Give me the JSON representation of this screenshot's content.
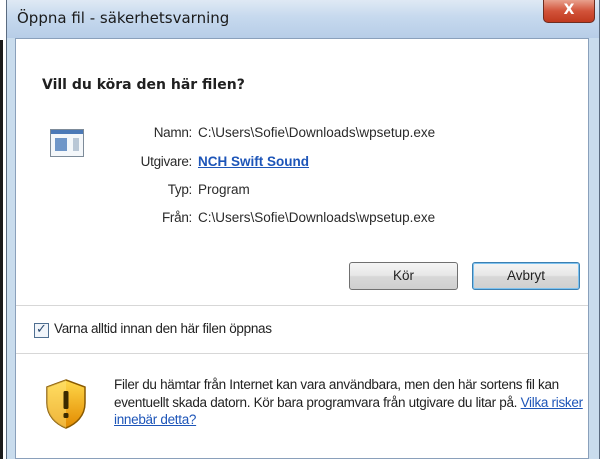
{
  "window": {
    "title": "Öppna fil - säkerhetsvarning",
    "close_glyph": "X"
  },
  "dialog": {
    "heading": "Vill du köra den här filen?",
    "icon": "application-file-icon",
    "fields": {
      "name_label": "Namn:",
      "name_value": "C:\\Users\\Sofie\\Downloads\\wpsetup.exe",
      "publisher_label": "Utgivare:",
      "publisher_value": "NCH Swift Sound",
      "type_label": "Typ:",
      "type_value": "Program",
      "from_label": "Från:",
      "from_value": "C:\\Users\\Sofie\\Downloads\\wpsetup.exe"
    },
    "buttons": {
      "run": "Kör",
      "cancel": "Avbryt"
    },
    "checkbox": {
      "label": "Varna alltid innan den här filen öppnas",
      "checked": true,
      "glyph": "✓"
    },
    "warning": {
      "icon": "shield-warning-icon",
      "text": "Filer du hämtar från Internet kan vara användbara, men den här sortens fil kan eventuellt skada datorn. Kör bara programvara från utgivare du litar på.",
      "link": "Vilka risker innebär detta?"
    }
  }
}
